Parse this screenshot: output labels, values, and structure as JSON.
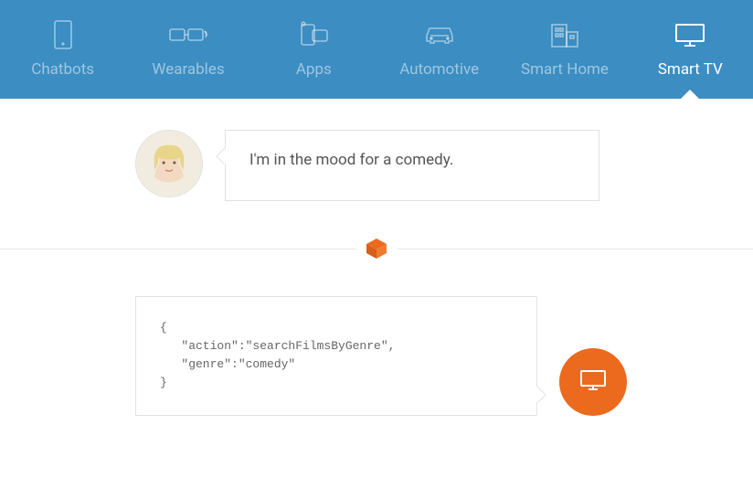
{
  "tabs": [
    {
      "id": "chatbots",
      "label": "Chatbots",
      "icon": "chatbot-icon",
      "active": false
    },
    {
      "id": "wearables",
      "label": "Wearables",
      "icon": "glasses-icon",
      "active": false
    },
    {
      "id": "apps",
      "label": "Apps",
      "icon": "apps-icon",
      "active": false
    },
    {
      "id": "automotive",
      "label": "Automotive",
      "icon": "car-icon",
      "active": false
    },
    {
      "id": "smart-home",
      "label": "Smart Home",
      "icon": "building-icon",
      "active": false
    },
    {
      "id": "smart-tv",
      "label": "Smart TV",
      "icon": "tv-icon",
      "active": true
    }
  ],
  "user_message": "I'm in the mood for a comedy.",
  "divider_icon": "api-box-icon",
  "response_code": "{\n   \"action\":\"searchFilmsByGenre\",\n   \"genre\":\"comedy\"\n}",
  "response_avatar_icon": "tv-icon",
  "colors": {
    "tab_bg": "#3b8dc2",
    "accent_orange": "#eb6a1e"
  }
}
